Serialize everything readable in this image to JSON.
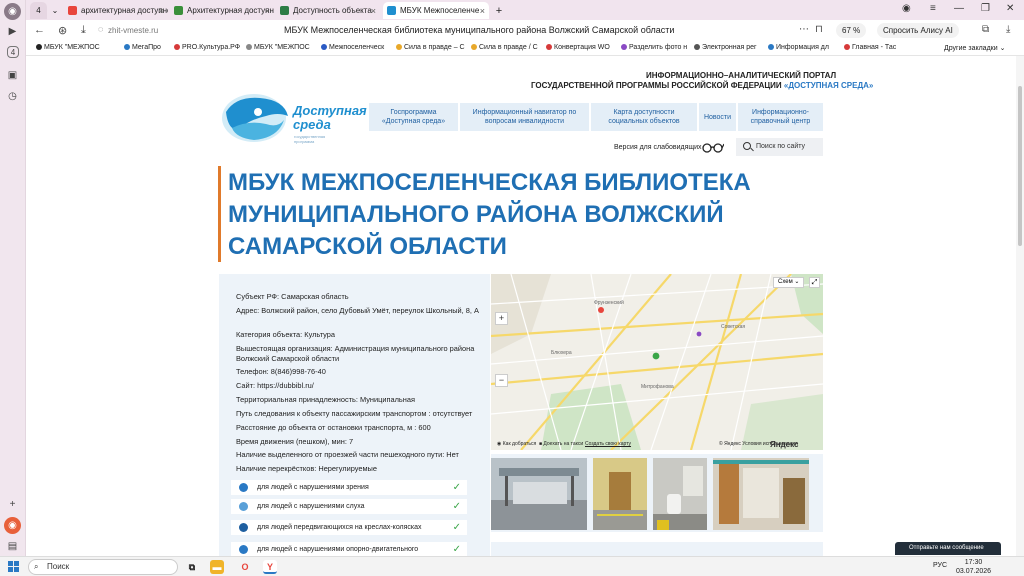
{
  "browser": {
    "tab_count_badge": "4",
    "tabs": [
      {
        "label": "архитектурная доступно",
        "color": "#e8453c"
      },
      {
        "label": "Архитектурная доступно",
        "color": "#3a8f3a"
      },
      {
        "label": "Доступность объекта",
        "color": "#2d7d46"
      },
      {
        "label": "МБУК Межпоселенче",
        "color": "#1f8fcf"
      }
    ],
    "url": "zhit-vmeste.ru",
    "page_title": "МБУК Межпоселенческая библиотека муниципального района Волжский Самарской области",
    "zoom": "67 %",
    "alice": "Спросить Алису AI",
    "bookmarks": [
      "МБУК \"МЕЖПОС",
      "МегаПро",
      "PRO.Культура.РФ",
      "МБУК \"МЕЖПОС",
      "Межпоселенческ",
      "Сила в правде – С",
      "Сила в правде / С",
      "Конвертация WO",
      "Разделить фото н",
      "Электронная рег",
      "Информация дл",
      "Главная - Тас"
    ],
    "other_bookmarks": "Другие закладки"
  },
  "site": {
    "portal_line1": "ИНФОРМАЦИОННО–АНАЛИТИЧЕСКИЙ ПОРТАЛ",
    "portal_line2_prefix": "ГОСУДАРСТВЕННОЙ ПРОГРАММЫ РОССИЙСКОЙ ФЕДЕРАЦИИ ",
    "portal_line2_accent": "«ДОСТУПНАЯ СРЕДА»",
    "logo_line1": "Доступная",
    "logo_line2": "среда",
    "logo_sub": "государственная программа",
    "menu": [
      "Госпрограмма «Доступная среда»",
      "Информационный навигатор по вопросам инвалидности",
      "Карта доступности социальных объектов",
      "Новости",
      "Информационно-справочный центр"
    ],
    "vision_label": "Версия для слабовидящих",
    "search_placeholder": "Поиск по сайту"
  },
  "object": {
    "title": "МБУК МЕЖПОСЕЛЕНЧЕСКАЯ БИБЛИОТЕКА МУНИЦИПАЛЬНОГО РАЙОНА ВОЛЖСКИЙ САМАРСКОЙ ОБЛАСТИ",
    "fields": [
      "Субъект РФ: Самарская область",
      "Адрес: Волжский район, село Дубовый Умёт, переулок Школьный, 8, А",
      "Категория объекта: Культура",
      "Вышестоящая организация: Администрация муниципального района Волжский Самарской области",
      "Телефон: 8(846)998-76-40",
      "Сайт: https://dubbibl.ru/",
      "Территориальная принадлежность: Муниципальная",
      "Путь следования к объекту пассажирским транспортом : отсутствует",
      "Расстояние до объекта от остановки транспорта, м : 600",
      "Время движения (пешком), мин: 7",
      "Наличие выделенного от проезжей части пешеходного пути: Нет",
      "Наличие перекрёстков: Нерегулируемые"
    ],
    "disabilities": [
      "для людей с нарушениями зрения",
      "для людей с нарушениями слуха",
      "для людей передвигающихся на креслах-колясках",
      "для людей с нарушениями опорно-двигательного"
    ],
    "check": "✓"
  },
  "map": {
    "layer_button": "Схем",
    "labels": [
      "Фрунзенский",
      "Советская",
      "Митрофанова",
      "Блюхера"
    ],
    "route_button": "Как добраться",
    "taxi_button": "Доехать на такси",
    "create_map": "Создать свою карту",
    "terms": "© Яндекс Условия использования",
    "brand": "Яндекс Карты"
  },
  "taskbar": {
    "search": "Поиск",
    "notification": "Отправьте нам сообщение",
    "lang": "РУС",
    "time": "17:30",
    "date": "03.07.2026"
  }
}
